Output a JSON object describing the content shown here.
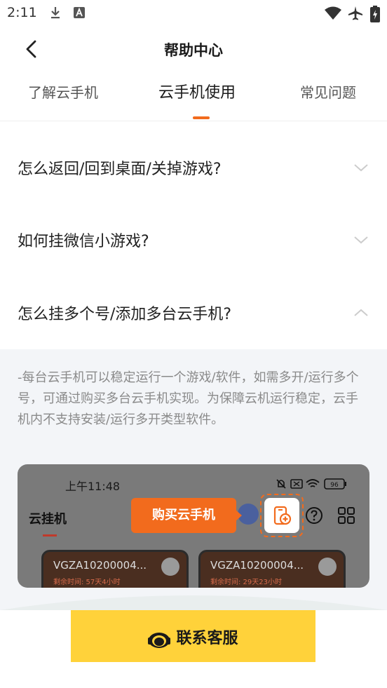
{
  "status_bar": {
    "time": "2:11",
    "icons": [
      "download-icon",
      "app-a-icon",
      "wifi-icon",
      "airplane-icon",
      "battery-charging-icon"
    ]
  },
  "header": {
    "title": "帮助中心",
    "back_icon": "chevron-left-icon"
  },
  "tabs": [
    {
      "label": "了解云手机",
      "active": false
    },
    {
      "label": "云手机使用",
      "active": true
    },
    {
      "label": "常见问题",
      "active": false
    }
  ],
  "accent_color": "#f26b1d",
  "faq": [
    {
      "question": "怎么返回/回到桌面/关掉游戏?",
      "expanded": false
    },
    {
      "question": "如何挂微信小游戏?",
      "expanded": false
    },
    {
      "question": "怎么挂多个号/添加多台云手机?",
      "expanded": true
    }
  ],
  "answer": {
    "text": "-每台云手机可以稳定运行一个游戏/软件，如需多开/运行多个号，可通过购买多台云手机实现。为保障云机运行稳定，云手机内不支持安装/运行多开类型软件。",
    "screenshot": {
      "time": "上午11:48",
      "battery": "96",
      "title": "云挂机",
      "cta": "购买云手机",
      "cards": [
        {
          "name": "VGZA10200004...",
          "sub": "剩余时间: 57天4小时"
        },
        {
          "name": "VGZA10200004...",
          "sub": "剩余时间: 29天23小时"
        }
      ]
    }
  },
  "contact": {
    "label": "联系客服",
    "color": "#ffd23a",
    "icon": "headset-icon"
  }
}
